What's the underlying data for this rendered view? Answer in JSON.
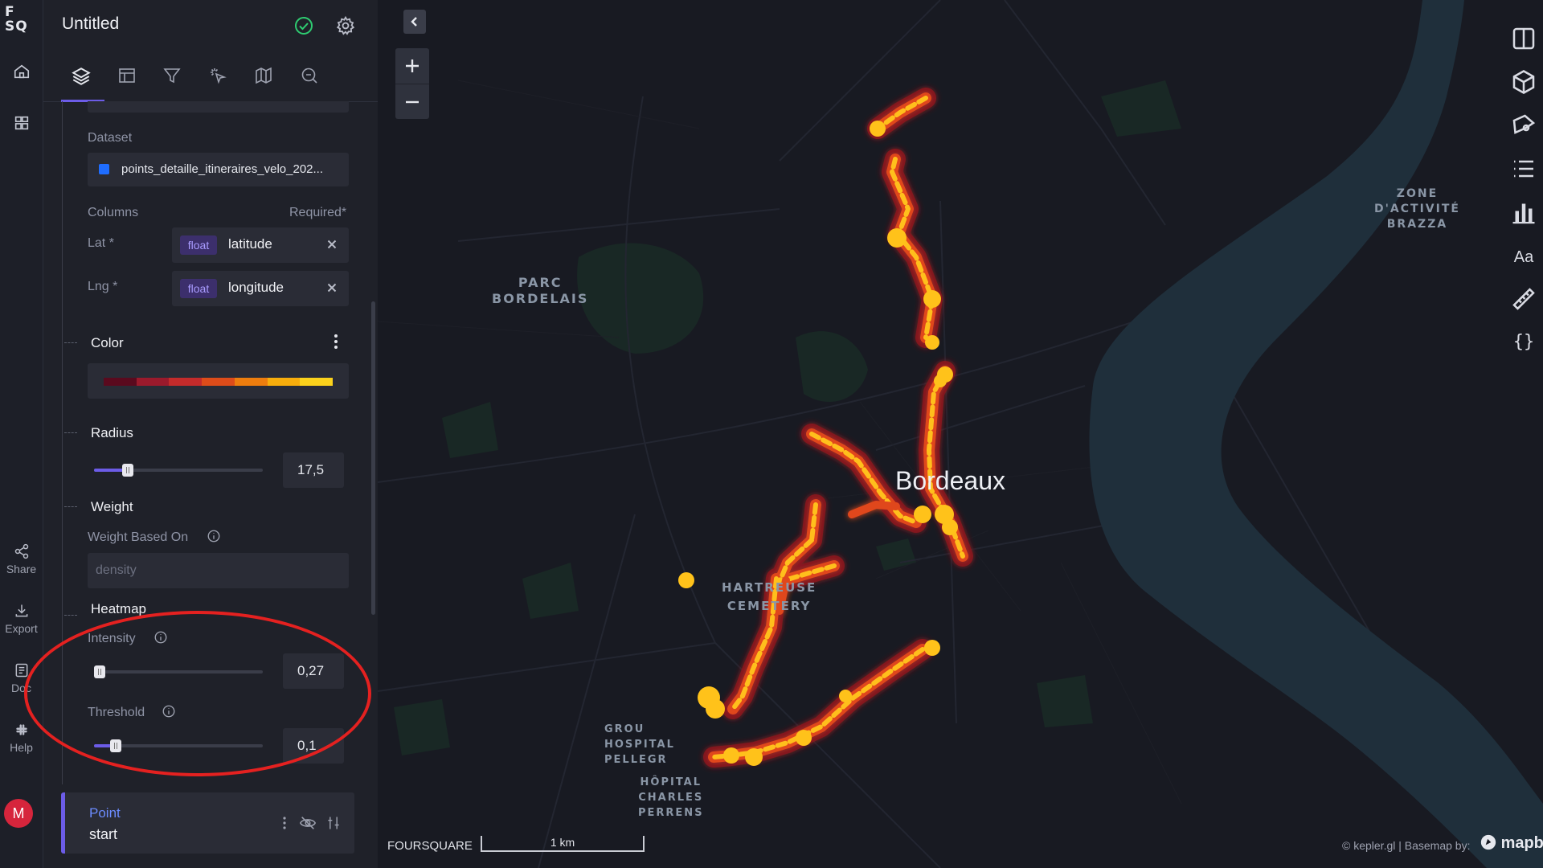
{
  "rail": {
    "logo": "F\nSQ",
    "share_label": "Share",
    "export_label": "Export",
    "docs_label": "Doc",
    "help_label": "Help",
    "avatar_letter": "M"
  },
  "panel": {
    "title": "Untitled",
    "dataset": {
      "label": "Dataset",
      "value": "points_detaille_itineraires_velo_202..."
    },
    "columns": {
      "label": "Columns",
      "required": "Required*",
      "lat": {
        "label": "Lat *",
        "type": "float",
        "value": "latitude"
      },
      "lng": {
        "label": "Lng *",
        "type": "float",
        "value": "longitude"
      }
    },
    "color": {
      "label": "Color",
      "palette": [
        "#5a0a1e",
        "#9b1a2c",
        "#c42b2b",
        "#dd4c1a",
        "#ed7d0e",
        "#f7ad0c",
        "#fbd21c"
      ]
    },
    "radius": {
      "label": "Radius",
      "value": "17,5",
      "fraction": 0.18
    },
    "weight": {
      "label": "Weight",
      "based_on_label": "Weight Based On",
      "based_on_value": "density"
    },
    "heatmap": {
      "label": "Heatmap",
      "intensity": {
        "label": "Intensity",
        "value": "0,27",
        "fraction": 0.0
      },
      "threshold": {
        "label": "Threshold",
        "value": "0,1",
        "fraction": 0.1
      }
    },
    "layer": {
      "type": "Point",
      "name": "start"
    }
  },
  "map": {
    "labels": {
      "parc": "PARC\nBORDELAIS",
      "zone": "ZONE\nD'ACTIVITÉ\nBRAZZA",
      "chartreuse": "HARTREUSE\nCEMETERY",
      "groupe": "GROU\nHOSPITAL\nPELLEGR",
      "hopital": "HÔPITAL\nCHARLES\nPERRENS"
    },
    "city": "Bordeaux",
    "scale_brand": "FOURSQUARE",
    "scale_label": "1 km",
    "attribution": "© kepler.gl | Basemap by:",
    "mapbox": "mapbo",
    "right_toolbar": [
      "split-map-icon",
      "3d-cube-icon",
      "draw-polygon-icon",
      "legend-list-icon",
      "chart-bar-icon",
      "text-label-icon",
      "ruler-icon",
      "json-braces-icon"
    ],
    "right_text_label": "Aa"
  },
  "colors": {
    "accent": "#6c5ce7",
    "success": "#2ecc71",
    "annotation": "#e42120",
    "heat_core": "#ffc21a",
    "heat_edge": "#c0281c"
  }
}
